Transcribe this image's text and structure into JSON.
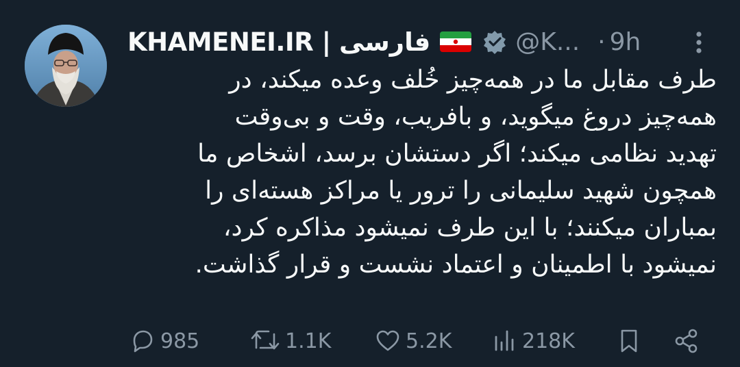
{
  "author": {
    "display_name": "KHAMENEI.IR | فارسی",
    "flag": "iran-flag",
    "verified": true,
    "handle": "@K...",
    "separator": "·",
    "time": "9h"
  },
  "tweet": {
    "lines": [
      "طرف مقابل ما در همه‌چیز خُلف وعده میکند، در",
      "همه‌چیز دروغ میگوید، و بافریب، وقت و بی‌وقت",
      "تهدید نظامی میکند؛ اگر دستشان برسد، اشخاص ما",
      "همچون شهید سلیمانی را ترور یا مراکز هسته‌ای را",
      "بمباران میکنند؛ با این طرف نمیشود مذاکره کرد،",
      "نمیشود با اطمینان و اعتماد نشست و قرار گذاشت."
    ]
  },
  "actions": {
    "replies": "985",
    "retweets": "1.1K",
    "likes": "5.2K",
    "views": "218K"
  },
  "colors": {
    "background": "#15202b",
    "text": "#f7f9f9",
    "muted": "#8b98a5"
  }
}
